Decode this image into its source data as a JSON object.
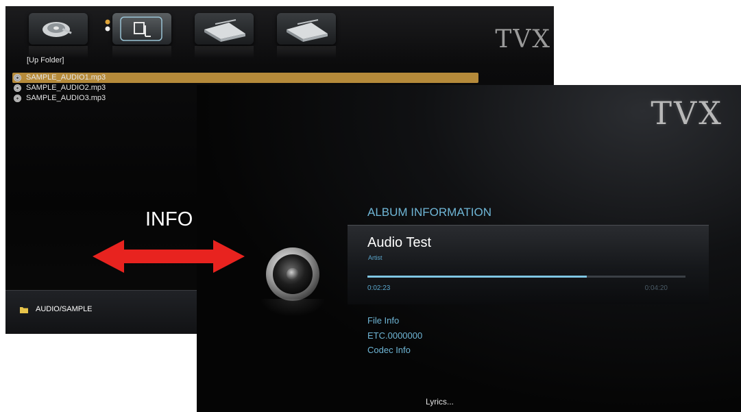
{
  "browser": {
    "logo": "TVX",
    "up_folder": "[Up Folder]",
    "files": [
      {
        "name": "SAMPLE_AUDIO1.mp3",
        "selected": true
      },
      {
        "name": "SAMPLE_AUDIO2.mp3",
        "selected": false
      },
      {
        "name": "SAMPLE_AUDIO3.mp3",
        "selected": false
      }
    ],
    "path": "AUDIO/SAMPLE",
    "toolbar_icons": [
      "hard-drive-icon",
      "usb-device-icon",
      "network-drive-icon",
      "network-drive-icon"
    ]
  },
  "callout": {
    "label": "INFO",
    "arrow_color": "#e8231f"
  },
  "player": {
    "logo": "TVX",
    "section_title": "ALBUM INFORMATION",
    "track_title": "Audio Test",
    "artist": "Artist",
    "current_time": "0:02:23",
    "total_time": "0:04:20",
    "progress": 0.69,
    "file_info": "File Info",
    "etc": "ETC.0000000",
    "codec_info": "Codec Info",
    "lyrics": "Lyrics..."
  },
  "colors": {
    "accent_blue": "#6fb6d6",
    "selection_gold": "#b58a3a"
  }
}
